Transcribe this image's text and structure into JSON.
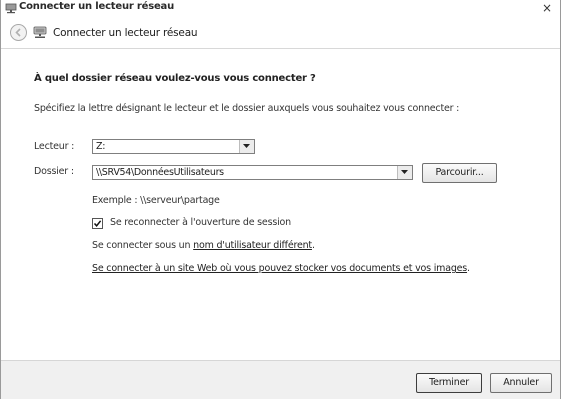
{
  "window": {
    "title": "Connecter un lecteur réseau",
    "close_glyph": "×"
  },
  "nav": {
    "title": "Connecter un lecteur réseau"
  },
  "main": {
    "heading": "À quel dossier réseau voulez-vous vous connecter ?",
    "instruction": "Spécifiez la lettre désignant le lecteur et le dossier auxquels vous souhaitez vous connecter :",
    "drive_label": "Lecteur :",
    "drive_value": "Z:",
    "folder_label": "Dossier :",
    "folder_value": "\\\\SRV54\\DonnéesUtilisateurs",
    "browse_label": "Parcourir...",
    "example": "Exemple : \\\\serveur\\partage",
    "reconnect_checked": true,
    "reconnect_label": "Se reconnecter à l'ouverture de session",
    "other_user_prefix": "Se connecter sous un ",
    "other_user_link": "nom d'utilisateur différent",
    "other_user_suffix": ".",
    "website_link": "Se connecter à un site Web où vous pouvez stocker vos documents et vos images",
    "website_suffix": "."
  },
  "footer": {
    "finish_label": "Terminer",
    "cancel_label": "Annuler"
  }
}
